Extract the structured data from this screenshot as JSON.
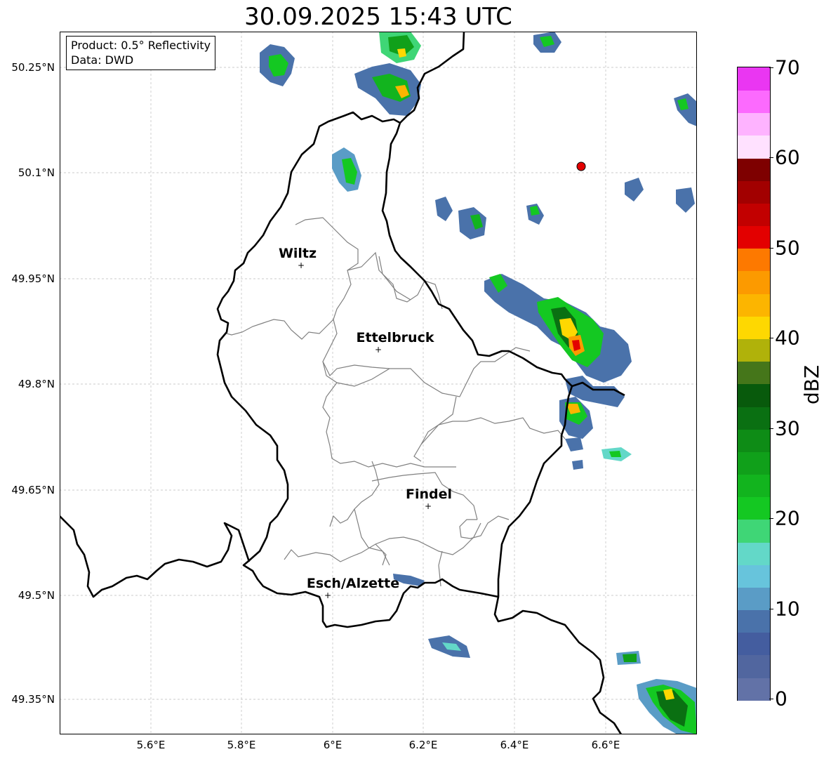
{
  "title": "30.09.2025 15:43 UTC",
  "info": {
    "product": "Product: 0.5° Reflectivity",
    "data": "Data: DWD"
  },
  "map": {
    "lon_range": [
      5.4,
      6.8
    ],
    "lat_range": [
      49.3,
      50.3
    ],
    "lat_ticks": [
      "50.25°N",
      "50.1°N",
      "49.95°N",
      "49.8°N",
      "49.65°N",
      "49.5°N",
      "49.35°N"
    ],
    "lon_ticks": [
      "5.6°E",
      "5.8°E",
      "6°E",
      "6.2°E",
      "6.4°E",
      "6.6°E"
    ],
    "gridlines": true,
    "radar_site_color": "#e30000",
    "cities": [
      {
        "name": "Wiltz",
        "lon": 5.93,
        "lat": 49.97
      },
      {
        "name": "Ettelbruck",
        "lon": 6.1,
        "lat": 49.85
      },
      {
        "name": "Findel",
        "lon": 6.21,
        "lat": 49.627
      },
      {
        "name": "Esch/Alzette",
        "lon": 5.99,
        "lat": 49.5
      }
    ]
  },
  "colorbar": {
    "label": "dBZ",
    "ticks": [
      "0",
      "10",
      "20",
      "30",
      "40",
      "50",
      "60",
      "70"
    ],
    "colors": [
      "#6272a7",
      "#51669f",
      "#445d9f",
      "#4a72aa",
      "#5a9cc6",
      "#67c4dc",
      "#63d8c8",
      "#3fd676",
      "#14c822",
      "#12b41e",
      "#10a01a",
      "#0e8c16",
      "#0a7012",
      "#085a0c",
      "#45761a",
      "#b0b20a",
      "#fed801",
      "#fcb500",
      "#fc9a00",
      "#fd7900",
      "#e30000",
      "#c20000",
      "#a20000",
      "#7e0000",
      "#ffe1ff",
      "#feb3ff",
      "#fc6afe",
      "#ea36f2"
    ]
  }
}
